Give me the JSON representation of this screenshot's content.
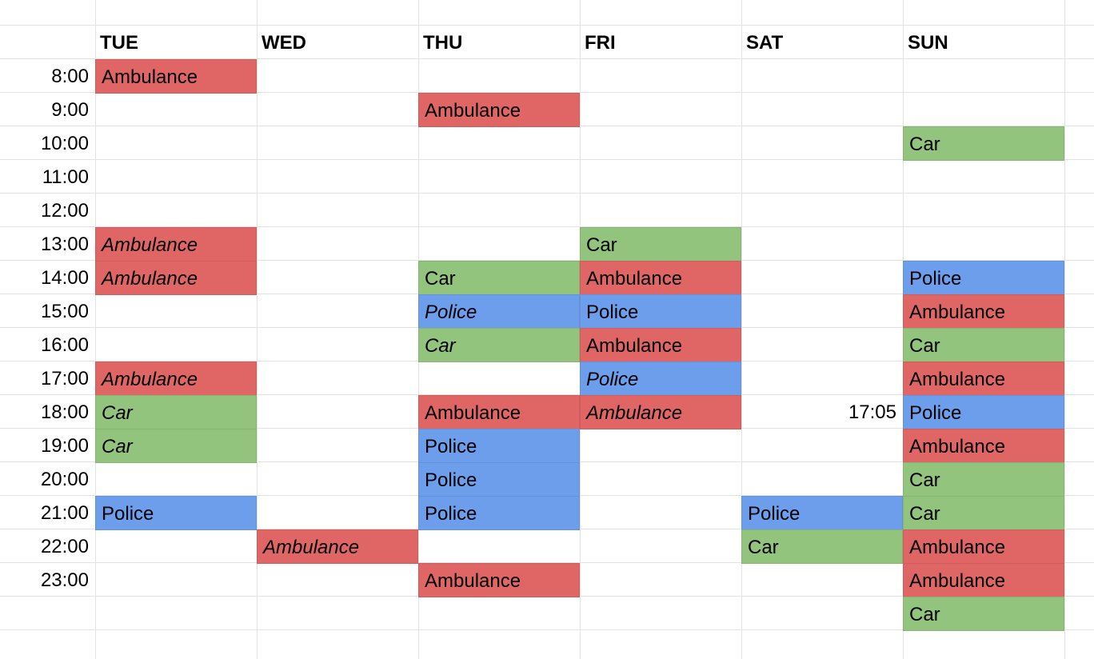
{
  "colors": {
    "Ambulance": "#e06666",
    "Car": "#93c47d",
    "Police": "#6d9eeb",
    "grid": "#e2e2e2"
  },
  "days": [
    "TUE",
    "WED",
    "THU",
    "FRI",
    "SAT",
    "SUN"
  ],
  "times": [
    "8:00",
    "9:00",
    "10:00",
    "11:00",
    "12:00",
    "13:00",
    "14:00",
    "15:00",
    "16:00",
    "17:00",
    "18:00",
    "19:00",
    "20:00",
    "21:00",
    "22:00",
    "23:00"
  ],
  "events": [
    {
      "day": 0,
      "slot": 0,
      "type": "Ambulance",
      "italic": false
    },
    {
      "day": 0,
      "slot": 5,
      "type": "Ambulance",
      "italic": true
    },
    {
      "day": 0,
      "slot": 6,
      "type": "Ambulance",
      "italic": true
    },
    {
      "day": 0,
      "slot": 9,
      "type": "Ambulance",
      "italic": true
    },
    {
      "day": 0,
      "slot": 10,
      "type": "Car",
      "italic": true
    },
    {
      "day": 0,
      "slot": 11,
      "type": "Car",
      "italic": true
    },
    {
      "day": 0,
      "slot": 13,
      "type": "Police",
      "italic": false
    },
    {
      "day": 1,
      "slot": 14,
      "type": "Ambulance",
      "italic": true
    },
    {
      "day": 2,
      "slot": 1,
      "type": "Ambulance",
      "italic": false
    },
    {
      "day": 2,
      "slot": 6,
      "type": "Car",
      "italic": false
    },
    {
      "day": 2,
      "slot": 7,
      "type": "Police",
      "italic": true
    },
    {
      "day": 2,
      "slot": 8,
      "type": "Car",
      "italic": true
    },
    {
      "day": 2,
      "slot": 10,
      "type": "Ambulance",
      "italic": false
    },
    {
      "day": 2,
      "slot": 11,
      "type": "Police",
      "italic": false
    },
    {
      "day": 2,
      "slot": 12,
      "type": "Police",
      "italic": false
    },
    {
      "day": 2,
      "slot": 13,
      "type": "Police",
      "italic": false
    },
    {
      "day": 2,
      "slot": 15,
      "type": "Ambulance",
      "italic": false
    },
    {
      "day": 3,
      "slot": 5,
      "type": "Car",
      "italic": false
    },
    {
      "day": 3,
      "slot": 6,
      "type": "Ambulance",
      "italic": false
    },
    {
      "day": 3,
      "slot": 7,
      "type": "Police",
      "italic": false
    },
    {
      "day": 3,
      "slot": 8,
      "type": "Ambulance",
      "italic": false
    },
    {
      "day": 3,
      "slot": 9,
      "type": "Police",
      "italic": true
    },
    {
      "day": 3,
      "slot": 10,
      "type": "Ambulance",
      "italic": true
    },
    {
      "day": 4,
      "slot": 13,
      "type": "Police",
      "italic": false
    },
    {
      "day": 4,
      "slot": 14,
      "type": "Car",
      "italic": false
    },
    {
      "day": 5,
      "slot": 2,
      "type": "Car",
      "italic": false
    },
    {
      "day": 5,
      "slot": 6,
      "type": "Police",
      "italic": false
    },
    {
      "day": 5,
      "slot": 7,
      "type": "Ambulance",
      "italic": false
    },
    {
      "day": 5,
      "slot": 8,
      "type": "Car",
      "italic": false
    },
    {
      "day": 5,
      "slot": 9,
      "type": "Ambulance",
      "italic": false
    },
    {
      "day": 5,
      "slot": 10,
      "type": "Police",
      "italic": false
    },
    {
      "day": 5,
      "slot": 11,
      "type": "Ambulance",
      "italic": false
    },
    {
      "day": 5,
      "slot": 12,
      "type": "Car",
      "italic": false
    },
    {
      "day": 5,
      "slot": 13,
      "type": "Car",
      "italic": false
    },
    {
      "day": 5,
      "slot": 14,
      "type": "Ambulance",
      "italic": false
    },
    {
      "day": 5,
      "slot": 15,
      "type": "Ambulance",
      "italic": false
    },
    {
      "day": 5,
      "slot": 16,
      "type": "Car",
      "italic": false
    }
  ],
  "notes": [
    {
      "day": 4,
      "slot": 10,
      "text": "17:05"
    }
  ]
}
